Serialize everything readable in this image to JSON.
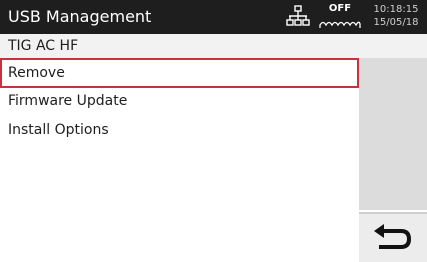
{
  "header": {
    "title": "USB Management",
    "network_icon": "network-icon",
    "cooling": {
      "icon": "cooling-unit-icon",
      "status": "OFF"
    },
    "time": "10:18:15",
    "date": "15/05/18"
  },
  "subtitle": "TIG AC HF",
  "menu": {
    "items": [
      {
        "label": "Remove",
        "selected": true
      },
      {
        "label": "Firmware Update",
        "selected": false
      },
      {
        "label": "Install Options",
        "selected": false
      }
    ]
  },
  "back_button": {
    "icon": "back-arrow-icon"
  },
  "colors": {
    "titlebar": "#1e1e1e",
    "selection_border": "#c8323c",
    "side_panel": "#dcdcdc",
    "back_button_bg": "#ececec"
  }
}
